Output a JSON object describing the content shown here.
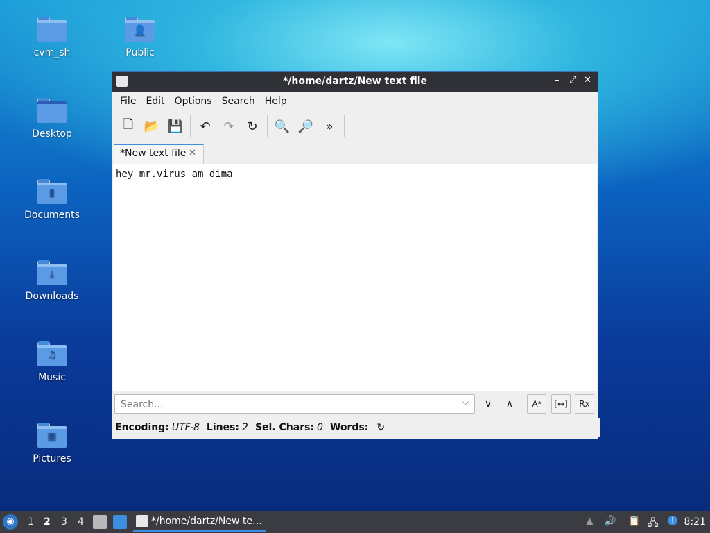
{
  "desktop": {
    "icons": [
      {
        "label": "cvm_sh",
        "icon": "folder-icon",
        "glyph": ""
      },
      {
        "label": "Public",
        "icon": "folder-public-icon",
        "glyph": "👤"
      },
      {
        "label": "Desktop",
        "icon": "folder-desktop-icon",
        "glyph": ""
      },
      {
        "label": "Documents",
        "icon": "folder-documents-icon",
        "glyph": "▮"
      },
      {
        "label": "Downloads",
        "icon": "folder-downloads-icon",
        "glyph": "⤓"
      },
      {
        "label": "Music",
        "icon": "folder-music-icon",
        "glyph": "♫"
      },
      {
        "label": "Pictures",
        "icon": "folder-pictures-icon",
        "glyph": "▣"
      }
    ]
  },
  "window": {
    "title": "*/home/dartz/New text file",
    "controls": {
      "minimize": "–",
      "restore": "⤢",
      "close": "✕"
    },
    "menu": [
      "File",
      "Edit",
      "Options",
      "Search",
      "Help"
    ],
    "toolbar": {
      "new": "🗋",
      "open": "📂",
      "save": "💾",
      "undo": "↶",
      "redo": "↷",
      "reload": "↻",
      "find": "🔍",
      "replace": "🔎",
      "more": "»"
    },
    "tab": {
      "label": "*New text file",
      "close": "✕"
    },
    "editor_text": "hey mr.virus am dima",
    "search": {
      "placeholder": "Search...",
      "dropdown": "⌵",
      "down": "∨",
      "up": "∧",
      "match_case": "Aᵃ",
      "whole_word": "[↔]",
      "regex": "Rx"
    },
    "status": {
      "encoding_label": "Encoding:",
      "encoding_value": "UTF-8",
      "lines_label": "Lines:",
      "lines_value": "2",
      "sel_label": "Sel. Chars:",
      "sel_value": "0",
      "words_label": "Words:",
      "refresh": "↻"
    }
  },
  "taskbar": {
    "start": "◉",
    "desktops": [
      "1",
      "2",
      "3",
      "4"
    ],
    "active_desktop": "2",
    "task_label": "*/home/dartz/New te…",
    "tray": {
      "notify": "▲",
      "volume": "🔊",
      "clipboard": "📋",
      "network": "🖧",
      "update": "!"
    },
    "clock": "8:21"
  }
}
